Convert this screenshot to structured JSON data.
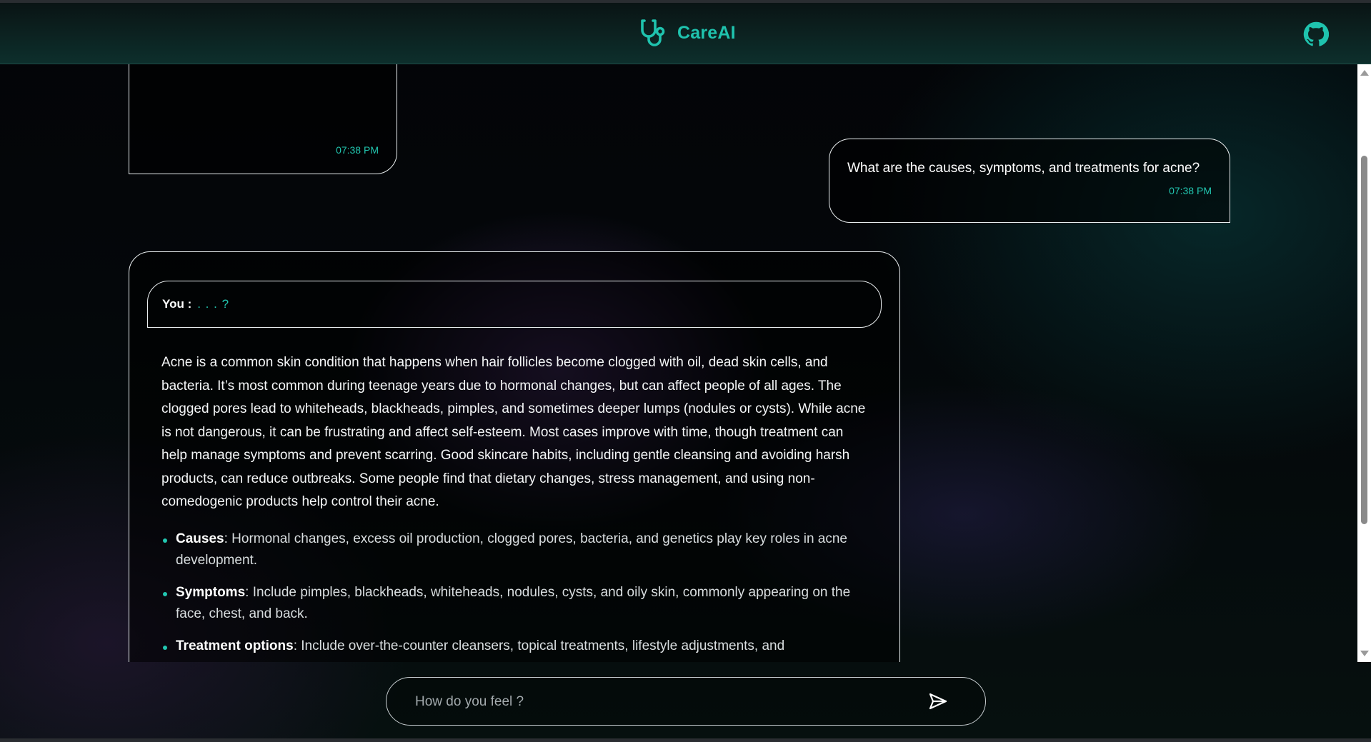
{
  "app": {
    "title": "CareAI"
  },
  "conversation": {
    "previous_bot_time": "07:38 PM",
    "user_message": {
      "text": "What are the causes, symptoms, and treatments for acne?",
      "time": "07:38 PM"
    },
    "bot_message": {
      "you_label": "You :",
      "you_value": ". . . ?",
      "paragraph": "Acne is a common skin condition that happens when hair follicles become clogged with oil, dead skin cells, and bacteria. It’s most common during teenage years due to hormonal changes, but can affect people of all ages. The clogged pores lead to whiteheads, blackheads, pimples, and sometimes deeper lumps (nodules or cysts). While acne is not dangerous, it can be frustrating and affect self-esteem. Most cases improve with time, though treatment can help manage symptoms and prevent scarring. Good skincare habits, including gentle cleansing and avoiding harsh products, can reduce outbreaks. Some people find that dietary changes, stress management, and using non-comedogenic products help control their acne.",
      "points": [
        {
          "title": "Causes",
          "text": ": Hormonal changes, excess oil production, clogged pores, bacteria, and genetics play key roles in acne development."
        },
        {
          "title": "Symptoms",
          "text": ": Include pimples, blackheads, whiteheads, nodules, cysts, and oily skin, commonly appearing on the face, chest, and back."
        },
        {
          "title": "Treatment options",
          "text": ": Include over-the-counter cleansers, topical treatments, lifestyle adjustments, and"
        }
      ]
    }
  },
  "composer": {
    "placeholder": "How do you feel ?",
    "value": ""
  },
  "icons": {
    "logo": "stethoscope-icon",
    "github": "github-icon",
    "send": "send-icon"
  },
  "colors": {
    "accent": "#1fc3ae",
    "bubble_border": "#e9eef0"
  }
}
